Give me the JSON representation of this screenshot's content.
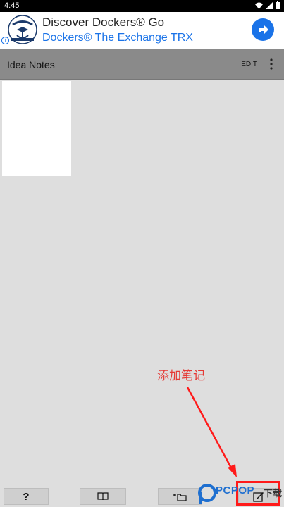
{
  "status_bar": {
    "time": "4:45"
  },
  "ad": {
    "title": "Discover Dockers® Go",
    "subtitle": "Dockers® The Exchange TRX",
    "brand": "DOCKERS",
    "info": "i",
    "accent": "#1a73e8"
  },
  "app_bar": {
    "title": "Idea Notes",
    "edit_label": "EDIT"
  },
  "annotation": {
    "text": "添加笔记",
    "color": "#e53935"
  },
  "bottom_bar": {
    "help_label": "?"
  },
  "watermark": {
    "text": "PCPOP",
    "text2": "下载"
  }
}
